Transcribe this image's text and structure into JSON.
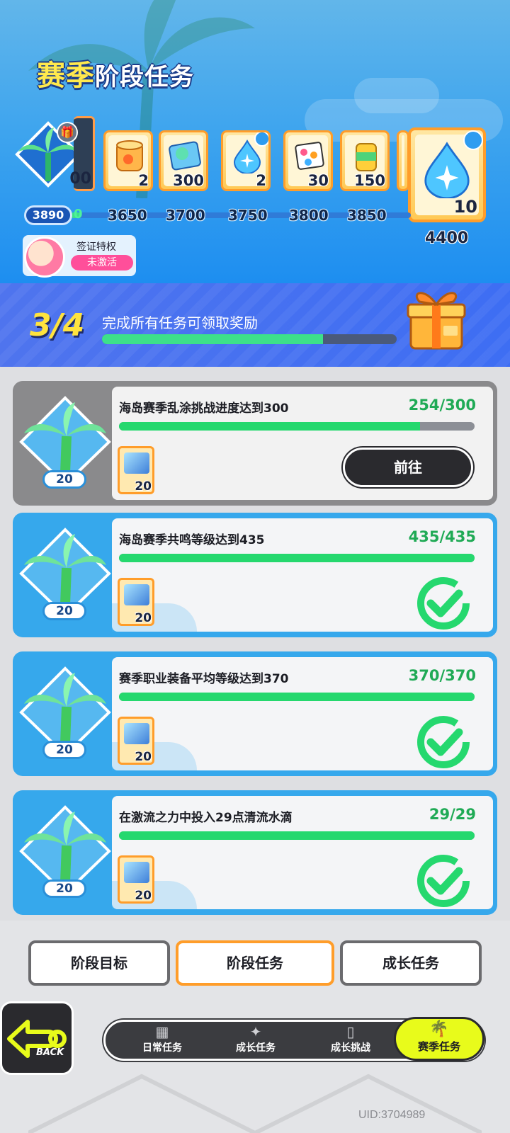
{
  "header": {
    "title_part1": "赛季",
    "title_part2": "阶段任务",
    "partial_reward_qty": "00",
    "rewards": [
      {
        "qty": "2",
        "icon": "canned-food-icon"
      },
      {
        "qty": "300",
        "icon": "fish-card-icon"
      },
      {
        "qty": "2",
        "icon": "water-drop-icon"
      },
      {
        "qty": "30",
        "icon": "sticker-pack-icon"
      },
      {
        "qty": "150",
        "icon": "drink-can-icon"
      }
    ],
    "milestone_start": "0",
    "milestones": [
      "3650",
      "3700",
      "3750",
      "3800",
      "3850"
    ],
    "current_score": "3890",
    "big_reward": {
      "qty": "10",
      "value": "4400",
      "icon": "water-drop-icon"
    },
    "visa": {
      "label": "签证特权",
      "status": "未激活"
    }
  },
  "progress": {
    "count": "3/4",
    "text": "完成所有任务可领取奖励",
    "fraction": 0.75
  },
  "tasks": [
    {
      "name": "海岛赛季乱涂挑战进度达到300",
      "progress": "254/300",
      "fraction": 0.847,
      "level": "20",
      "reward_qty": "20",
      "state": "open",
      "action": "前往"
    },
    {
      "name": "海岛赛季共鸣等级达到435",
      "progress": "435/435",
      "fraction": 1.0,
      "level": "20",
      "reward_qty": "20",
      "state": "done"
    },
    {
      "name": "赛季职业装备平均等级达到370",
      "progress": "370/370",
      "fraction": 1.0,
      "level": "20",
      "reward_qty": "20",
      "state": "done"
    },
    {
      "name": "在激流之力中投入29点清流水滴",
      "progress": "29/29",
      "fraction": 1.0,
      "level": "20",
      "reward_qty": "20",
      "state": "done"
    }
  ],
  "tabs": [
    "阶段目标",
    "阶段任务",
    "成长任务"
  ],
  "back_label": "BACK",
  "nav": [
    "日常任务",
    "成长任务",
    "成长挑战",
    "赛季任务"
  ],
  "uid": "UID:3704989",
  "colors": {
    "accent_green": "#25d86e",
    "active_tab": "#ff9d2a",
    "nav_active": "#e8fb1b"
  }
}
